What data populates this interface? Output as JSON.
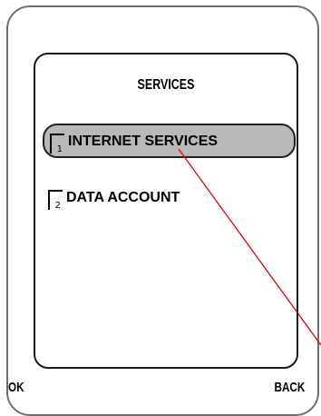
{
  "screen": {
    "title": "SERVICES"
  },
  "menu": {
    "items": [
      {
        "number": "1",
        "label": "INTERNET SERVICES",
        "selected": true
      },
      {
        "number": "2",
        "label": "DATA ACCOUNT",
        "selected": false
      }
    ]
  },
  "softkeys": {
    "left": "OK",
    "right": "BACK"
  },
  "colors": {
    "selection_fill": "#b9b9b9",
    "pointer_line": "#e00000"
  }
}
